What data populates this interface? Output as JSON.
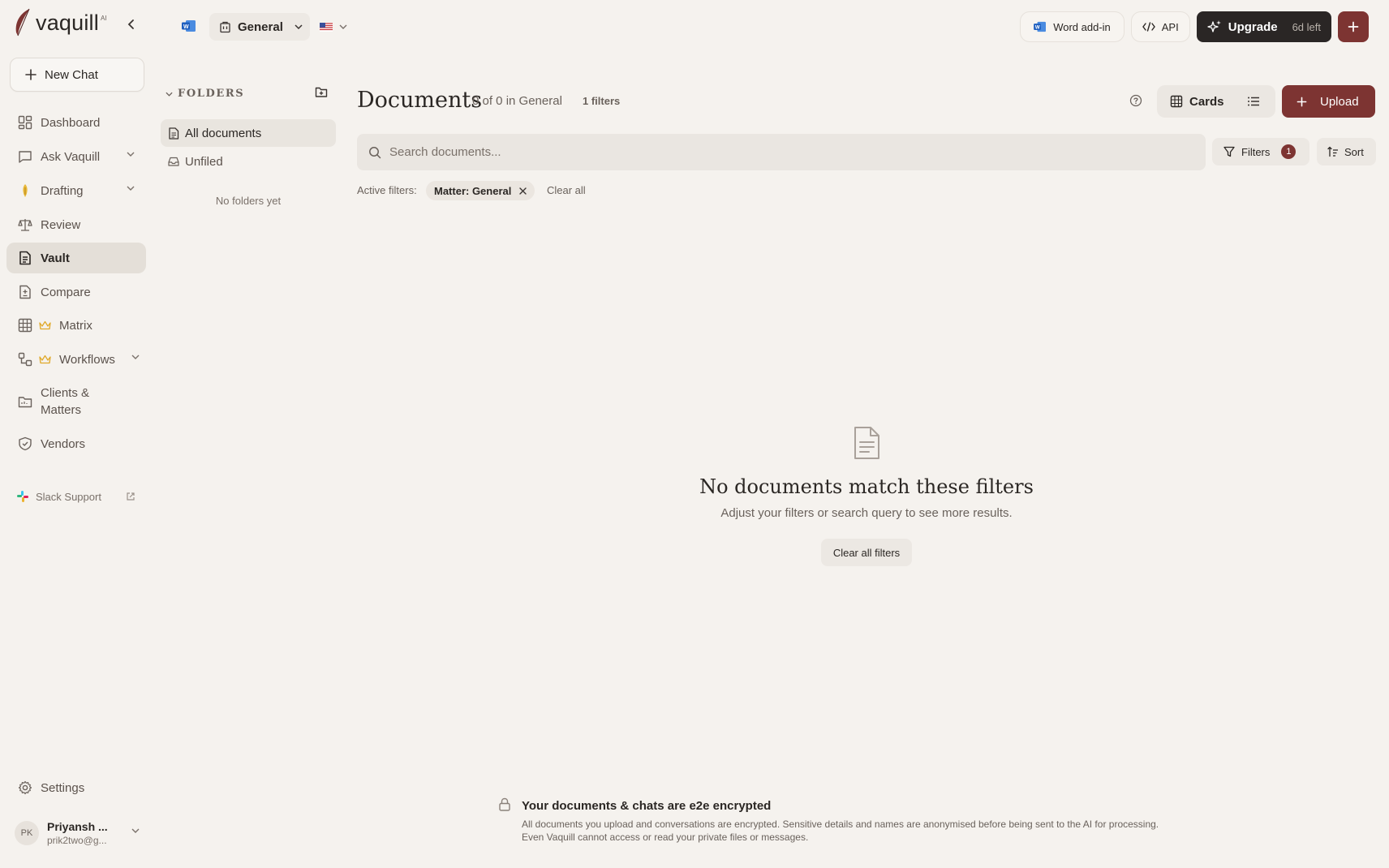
{
  "app": {
    "brand": "vaquill",
    "brand_badge": "AI"
  },
  "sidebar": {
    "new_chat": "New Chat",
    "items": [
      {
        "label": "Dashboard",
        "icon": "dashboard-icon"
      },
      {
        "label": "Ask Vaquill",
        "icon": "chat-icon",
        "expandable": true
      },
      {
        "label": "Drafting",
        "icon": "pen-nib-icon",
        "expandable": true
      },
      {
        "label": "Review",
        "icon": "scale-icon"
      },
      {
        "label": "Vault",
        "icon": "document-icon",
        "active": true
      },
      {
        "label": "Compare",
        "icon": "compare-icon"
      },
      {
        "label": "Matrix",
        "icon": "grid-icon",
        "premium": true
      },
      {
        "label": "Workflows",
        "icon": "workflow-icon",
        "premium": true,
        "expandable": true
      },
      {
        "label": "Clients & Matters",
        "icon": "folder-icon"
      },
      {
        "label": "Vendors",
        "icon": "shield-icon"
      }
    ],
    "slack_support": "Slack Support",
    "settings": "Settings",
    "user": {
      "initials": "PK",
      "name": "Priyansh ...",
      "email": "prik2two@g..."
    }
  },
  "topbar": {
    "matter": "General",
    "region_flag": "🇺🇸",
    "word_addin": "Word add-in",
    "api": "API",
    "upgrade": "Upgrade",
    "trial_left": "6d left"
  },
  "folders": {
    "heading": "FOLDERS",
    "items": [
      {
        "label": "All documents",
        "active": true
      },
      {
        "label": "Unfiled"
      }
    ],
    "empty": "No folders yet"
  },
  "documents": {
    "title": "Documents",
    "count": "0 of 0 in General",
    "filter_count": "1 filters",
    "view_cards": "Cards",
    "upload": "Upload",
    "search_placeholder": "Search documents...",
    "filters_label": "Filters",
    "filters_badge": "1",
    "sort_label": "Sort",
    "active_filters_label": "Active filters:",
    "active_filter_chip": "Matter: General",
    "clear_all": "Clear all"
  },
  "empty_state": {
    "title": "No documents match these filters",
    "subtitle": "Adjust your filters or search query to see more results.",
    "button": "Clear all filters"
  },
  "footer": {
    "title": "Your documents & chats are e2e encrypted",
    "line1": "All documents you upload and conversations are encrypted. Sensitive details and names are anonymised before being sent to the AI for processing.",
    "line2": "Even Vaquill cannot access or read your private files or messages."
  },
  "colors": {
    "accent": "#7d3432",
    "background": "#f5f2ee",
    "dark_button": "#2a2625"
  }
}
